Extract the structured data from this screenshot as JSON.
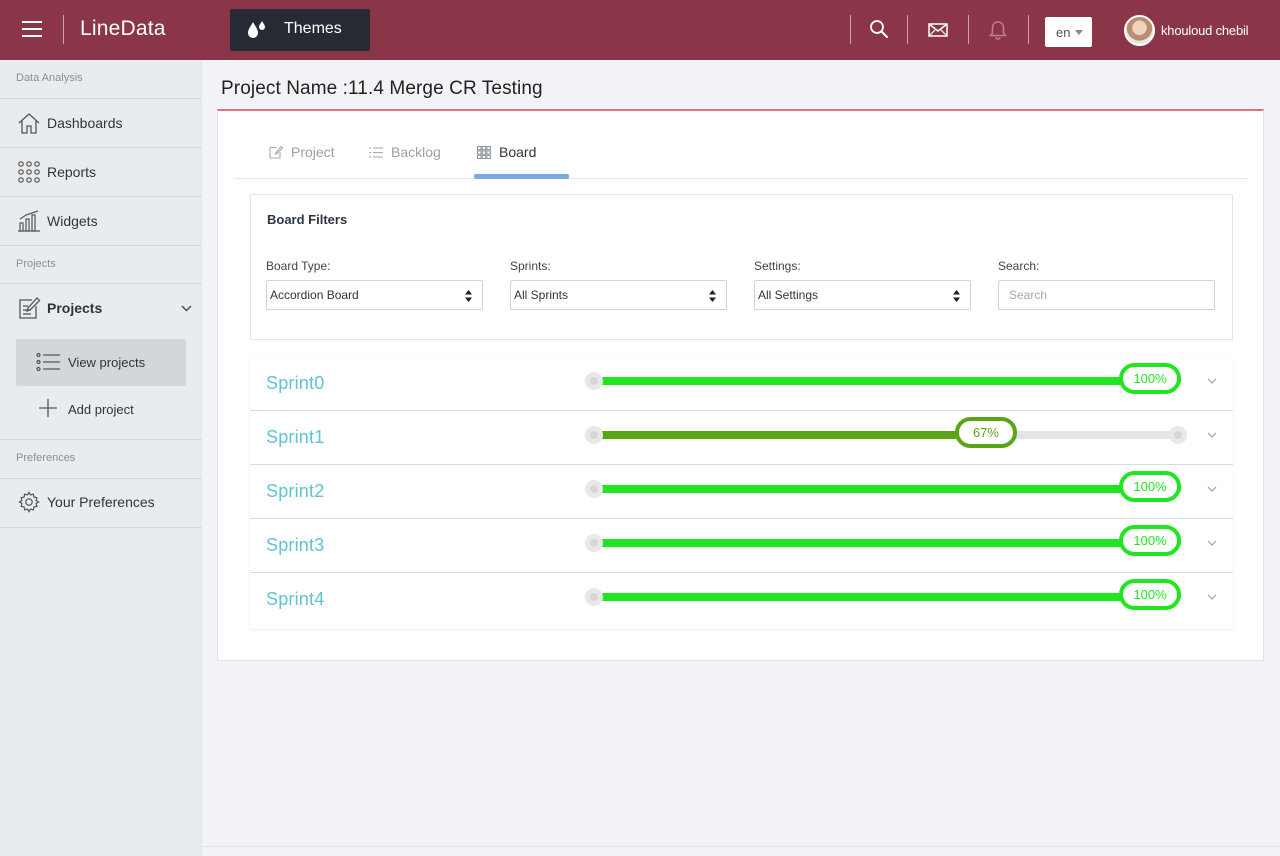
{
  "header": {
    "brand": "LineData",
    "themes_label": "Themes",
    "lang": "en",
    "user_name": "khouloud chebil",
    "colors": {
      "bar": "#8b3549",
      "themes_bg": "#262b33"
    }
  },
  "sidebar": {
    "section_analysis": "Data Analysis",
    "dashboards": "Dashboards",
    "reports": "Reports",
    "widgets": "Widgets",
    "section_projects": "Projects",
    "projects": "Projects",
    "view_projects": "View projects",
    "add_project": "Add project",
    "section_preferences": "Preferences",
    "your_preferences": "Your Preferences"
  },
  "page": {
    "title": "Project Name :11.4 Merge CR Testing"
  },
  "tabs": {
    "project": "Project",
    "backlog": "Backlog",
    "board": "Board",
    "active": "Board"
  },
  "filters": {
    "title": "Board Filters",
    "board_type_label": "Board Type:",
    "board_type_value": "Accordion Board",
    "sprints_label": "Sprints:",
    "sprints_value": "All Sprints",
    "settings_label": "Settings:",
    "settings_value": "All Settings",
    "search_label": "Search:",
    "search_placeholder": "Search"
  },
  "sprints": [
    {
      "name": "Sprint0",
      "progress": 100,
      "label": "100%",
      "color": "#1fe61f"
    },
    {
      "name": "Sprint1",
      "progress": 67,
      "label": "67%",
      "color": "#5aa514"
    },
    {
      "name": "Sprint2",
      "progress": 100,
      "label": "100%",
      "color": "#1fe61f"
    },
    {
      "name": "Sprint3",
      "progress": 100,
      "label": "100%",
      "color": "#1fe61f"
    },
    {
      "name": "Sprint4",
      "progress": 100,
      "label": "100%",
      "color": "#1fe61f"
    }
  ]
}
